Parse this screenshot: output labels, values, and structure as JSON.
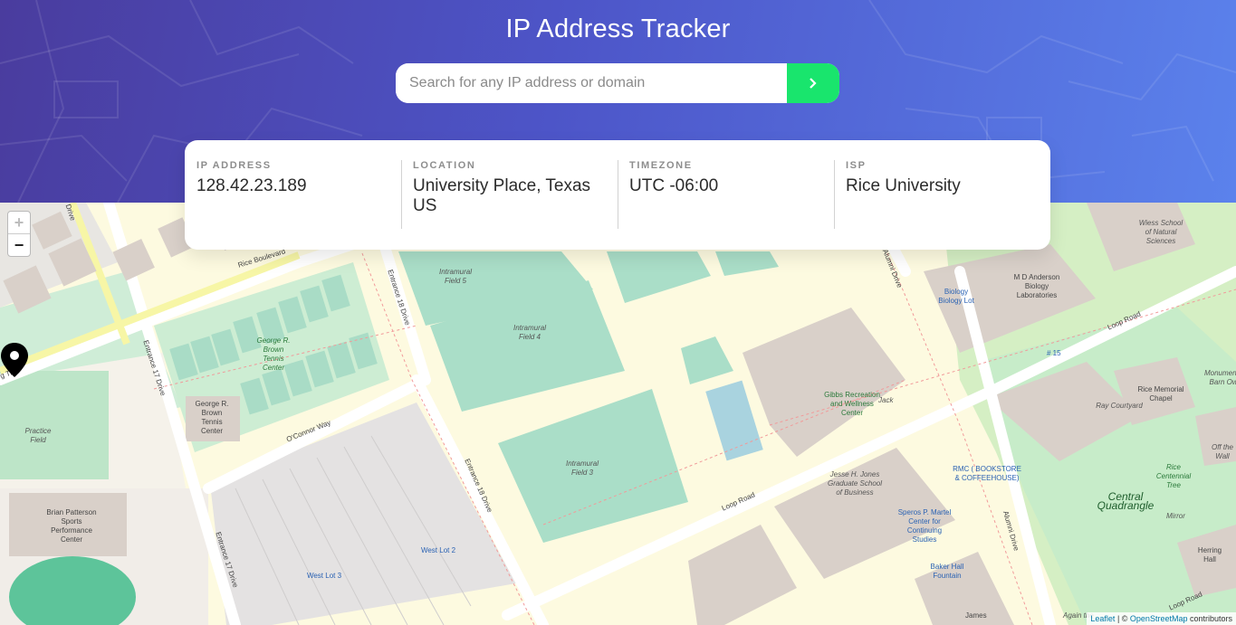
{
  "header": {
    "title": "IP Address Tracker",
    "search_placeholder": "Search for any IP address or domain"
  },
  "info": [
    {
      "label": "IP ADDRESS",
      "value": "128.42.23.189"
    },
    {
      "label": "LOCATION",
      "value": "University Place, Texas US"
    },
    {
      "label": "TIMEZONE",
      "value": "UTC -06:00"
    },
    {
      "label": "ISP",
      "value": "Rice University"
    }
  ],
  "map": {
    "zoom_in": "+",
    "zoom_out": "−",
    "attribution": {
      "leaflet": "Leaflet",
      "sep": " | © ",
      "osm": "OpenStreetMap",
      "suffix": " contributors"
    },
    "labels": {
      "rice_blvd": "Rice Boulevard",
      "entrance17_top": "Entrance 17 Drive",
      "entrance17_bottom": "Entrance 17 Drive",
      "entrance18_top": "Entrance 18 Drive",
      "entrance18_bottom": "Entrance 18 Drive",
      "intramural5": "Intramural Field 5",
      "intramural4": "Intramural Field 4",
      "intramural3": "Intramural Field 3",
      "tennis_center": "George R. Brown Tennis Center",
      "tennis_building": "George R. Brown Tennis Center",
      "practice_field": "Practice Field",
      "oconnor_way": "O'Connor Way",
      "brian_patterson": "Brian Patterson Sports Performance Center",
      "west_lot3": "West Lot 3",
      "west_lot2": "West Lot 2",
      "loop_road_mid": "Loop Road",
      "loop_road_top": "Loop Road",
      "loop_road_bottom": "Loop Road",
      "alumni_top": "Alumni Drive",
      "alumni_bottom": "Alumni Drive",
      "gibbs": "Gibbs Recreation and Wellness Center",
      "jack": "Jack",
      "jones": "Jesse H. Jones Graduate School of Business",
      "speros": "Speros P. Martel Center for Continuing Studies",
      "baker_fountain": "Baker Hall Fountain",
      "md_anderson": "M D Anderson Biology Laboratories",
      "wiess": "Wiess School of Natural Sciences",
      "biology": "Biology Biology Lot",
      "rmc": "RMC ( BOOKSTORE & COFFEEHOUSE)",
      "ray_courtyard": "Ray Courtyard",
      "rice_chapel": "Rice Memorial Chapel",
      "monumental": "Monumental Barn Owl",
      "centennial": "Rice Centennial Tree",
      "central_quad": "Central Quadrangle",
      "mirror": "Mirror",
      "herring": "Herring Hall",
      "off_the": "Off the Wall",
      "james": "James",
      "again": "Again the",
      "route15": "# 15",
      "trail": "g Trail",
      "drive_top": "Drive"
    }
  }
}
